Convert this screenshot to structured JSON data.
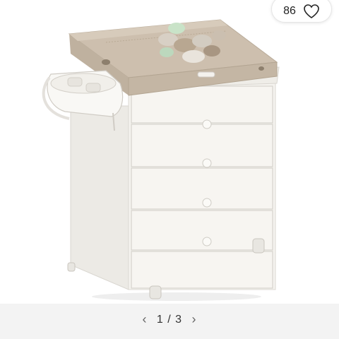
{
  "likes": {
    "count": "86",
    "icon": "heart-outline-icon"
  },
  "pager": {
    "current": "1",
    "separator": "/",
    "total": "3",
    "prev_icon": "chevron-left-icon",
    "next_icon": "chevron-right-icon"
  },
  "colors": {
    "background": "#ffffff",
    "bottom_bar": "#f3f3f3",
    "furniture_white": "#f4f2ee",
    "pad_beige": "#cdbfae"
  }
}
